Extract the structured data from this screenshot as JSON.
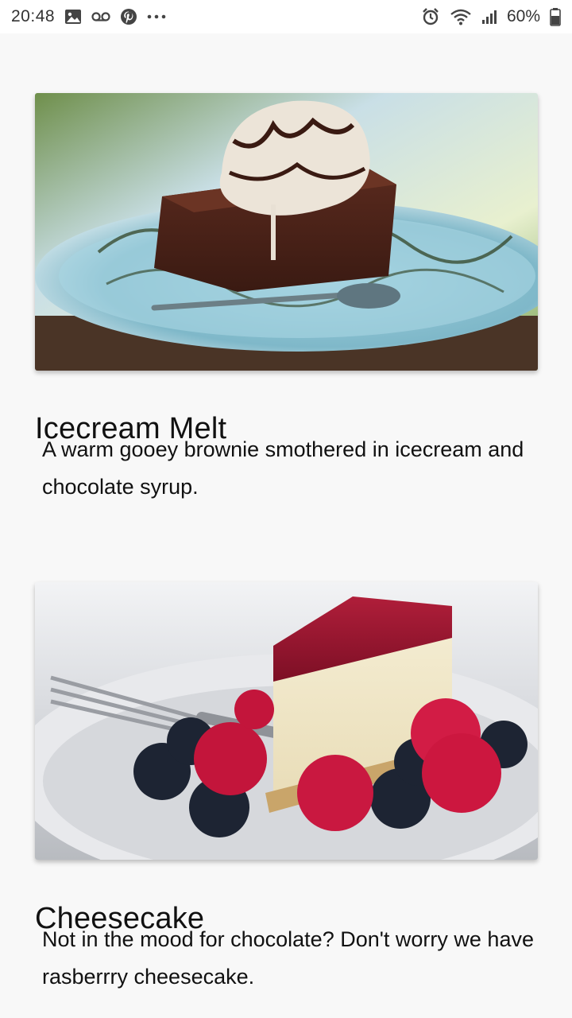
{
  "status_bar": {
    "time": "20:48",
    "battery": "60%",
    "left_icons": [
      "image-icon",
      "voicemail-icon",
      "pinterest-icon",
      "more-dots-icon"
    ],
    "right_icons": [
      "alarm-icon",
      "wifi-icon",
      "signal-icon",
      "battery-icon"
    ]
  },
  "cards": [
    {
      "title": "Icecream Melt",
      "description": "A warm gooey brownie smothered in icecream and chocolate syrup.",
      "image": "brownie-with-icecream"
    },
    {
      "title": "Cheesecake",
      "description": "Not in the mood for chocolate? Don't worry we have rasberrry cheesecake.",
      "image": "raspberry-cheesecake"
    }
  ]
}
